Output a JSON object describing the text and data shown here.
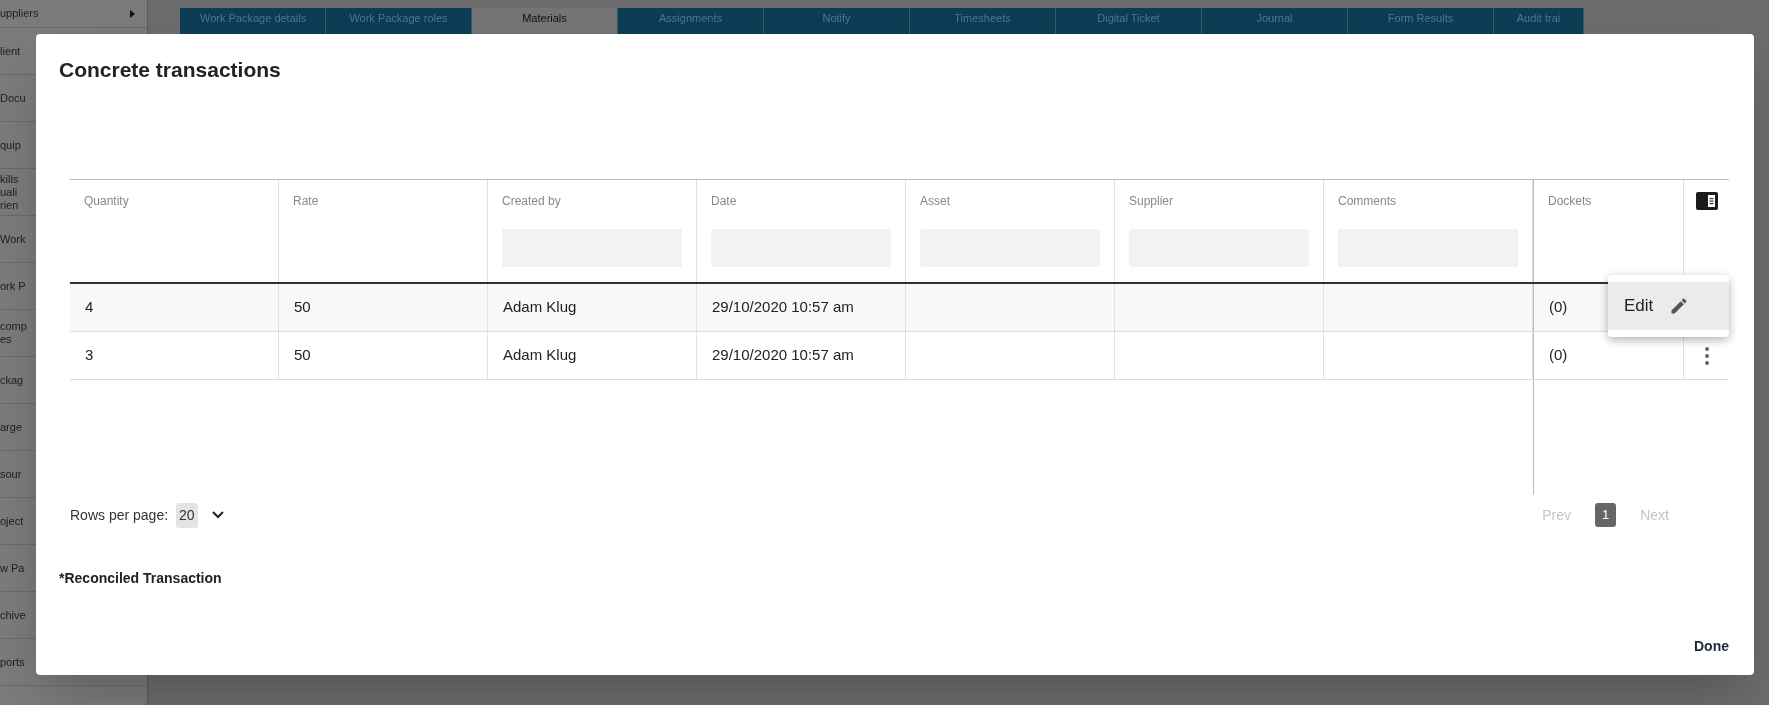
{
  "sidebar": {
    "items": [
      {
        "lines": [
          "uppliers"
        ],
        "has_submenu": true
      },
      {
        "lines": [
          "lient"
        ]
      },
      {
        "lines": [
          "Docu"
        ]
      },
      {
        "lines": [
          "quip"
        ]
      },
      {
        "lines": [
          "kills",
          "uali",
          "rien"
        ]
      },
      {
        "lines": [
          "Work"
        ]
      },
      {
        "lines": [
          "ork P"
        ]
      },
      {
        "lines": [
          "comp",
          "es"
        ]
      },
      {
        "lines": [
          "ckag"
        ]
      },
      {
        "lines": [
          "arge"
        ]
      },
      {
        "lines": [
          "sour"
        ]
      },
      {
        "lines": [
          "oject"
        ]
      },
      {
        "lines": [
          "w Pa"
        ]
      },
      {
        "lines": [
          "chive"
        ]
      },
      {
        "lines": [
          "ports"
        ]
      }
    ]
  },
  "tabs": [
    {
      "label": "Work Package details",
      "selected": false
    },
    {
      "label": "Work Package roles",
      "selected": false
    },
    {
      "label": "Materials",
      "selected": true
    },
    {
      "label": "Assignments",
      "selected": false
    },
    {
      "label": "Notify",
      "selected": false
    },
    {
      "label": "Timesheets",
      "selected": false
    },
    {
      "label": "Digital Ticket",
      "selected": false
    },
    {
      "label": "Journal",
      "selected": false
    },
    {
      "label": "Form Results",
      "selected": false
    },
    {
      "label": "Audit trai",
      "selected": false
    }
  ],
  "dialog": {
    "title": "Concrete transactions",
    "table": {
      "columns": [
        {
          "label": "Quantity",
          "filter": false
        },
        {
          "label": "Rate",
          "filter": false
        },
        {
          "label": "Created by",
          "filter": true
        },
        {
          "label": "Date",
          "filter": true
        },
        {
          "label": "Asset",
          "filter": true
        },
        {
          "label": "Supplier",
          "filter": true
        },
        {
          "label": "Comments",
          "filter": true
        },
        {
          "label": "Dockets",
          "filter": false
        }
      ],
      "rows": [
        {
          "cells": [
            "4",
            "50",
            "Adam Klug",
            "29/10/2020 10:57 am",
            "",
            "",
            "",
            "(0)"
          ],
          "selected": true,
          "menu_open": true
        },
        {
          "cells": [
            "3",
            "50",
            "Adam Klug",
            "29/10/2020 10:57 am",
            "",
            "",
            "",
            "(0)"
          ],
          "selected": false,
          "menu_open": false
        }
      ]
    },
    "row_menu": {
      "items": [
        {
          "label": "Edit",
          "selected": true
        }
      ]
    },
    "pagination": {
      "rows_per_page_label": "Rows per page:",
      "rows_per_page": "20",
      "prev": "Prev",
      "prev_disabled": true,
      "pages": [
        {
          "label": "1",
          "selected": true
        }
      ],
      "next": "Next",
      "next_disabled": true
    },
    "footnote": "*Reconciled Transaction",
    "done": "Done"
  }
}
